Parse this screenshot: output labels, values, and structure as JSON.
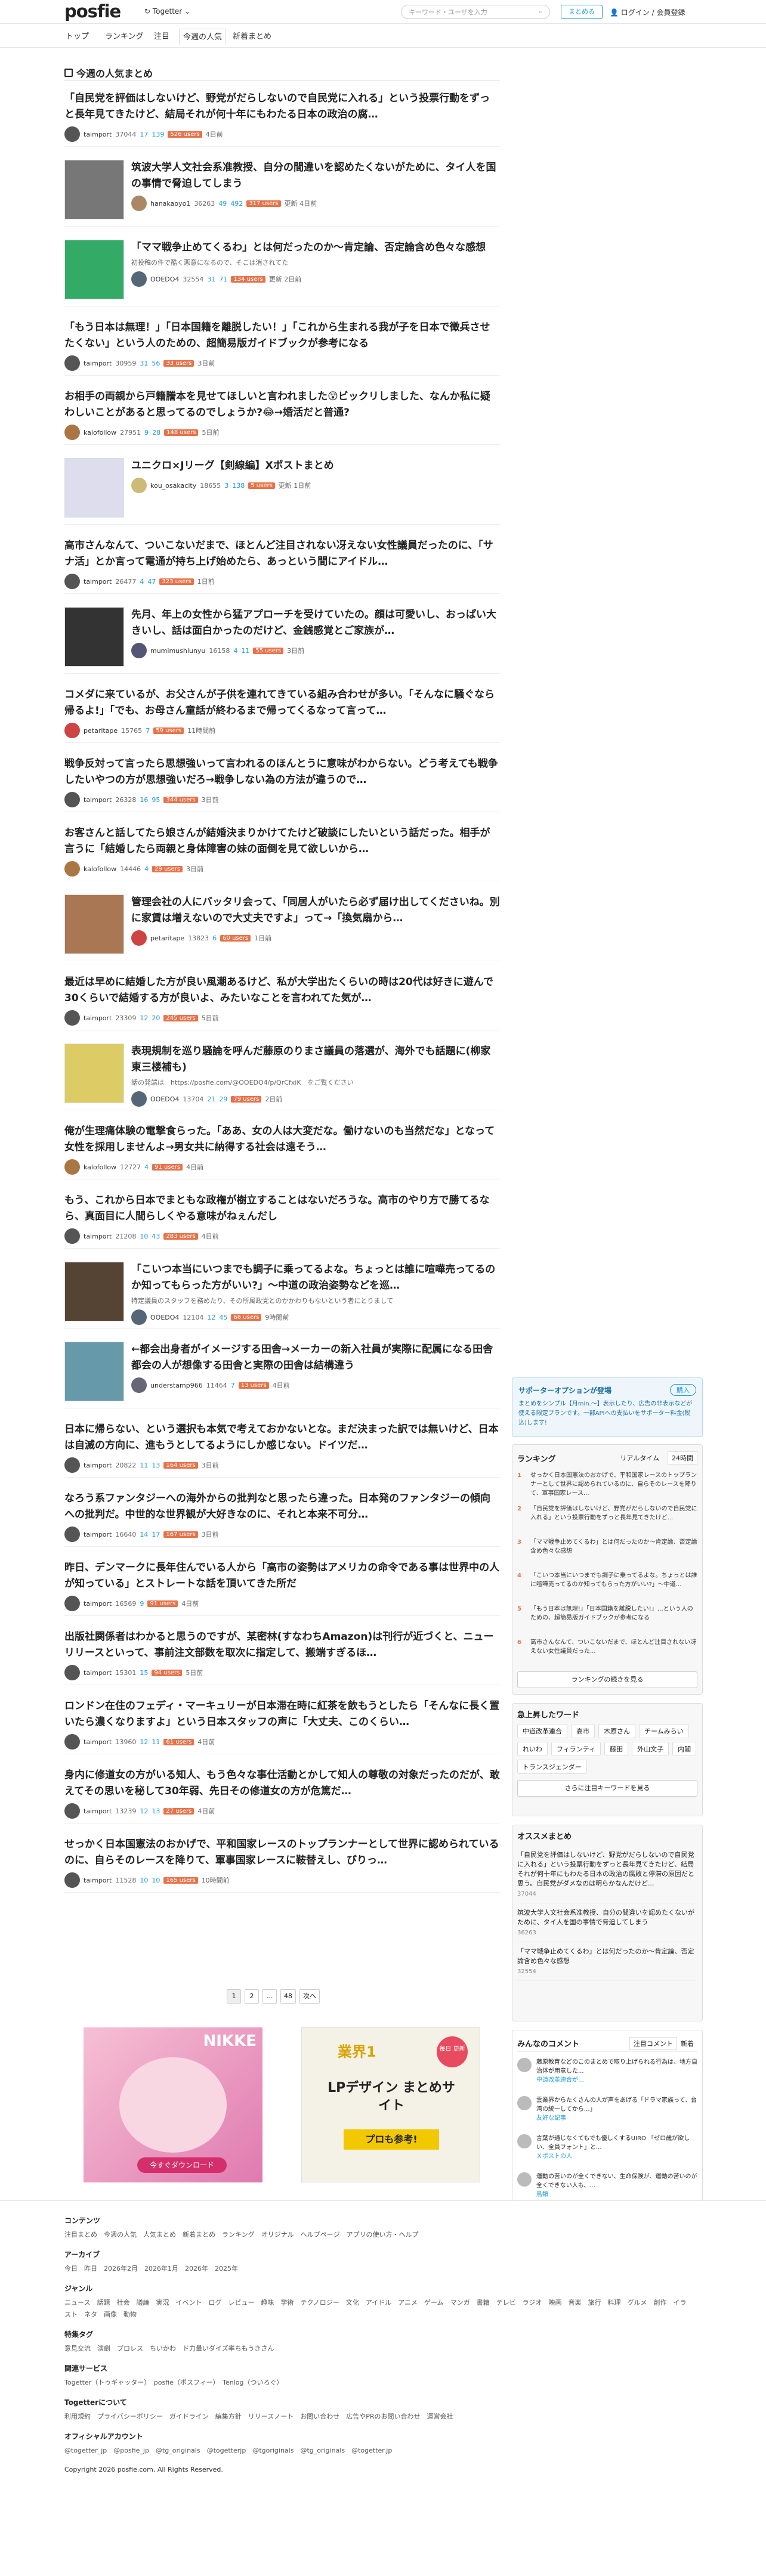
{
  "header": {
    "logo": "posfie",
    "together": "Togetter",
    "search_placeholder": "キーワード・ユーザを入力",
    "create": "まとめる",
    "login": "ログイン / 会員登録"
  },
  "nav": [
    "トップ",
    "ランキング",
    "注目",
    "今週の人気",
    "新着まとめ"
  ],
  "section_title": "今週の人気まとめ",
  "items": [
    {
      "title": "「自民党を評価はしないけど、野党がだらしないので自民党に入れる」という投票行動をずっと長年見てきたけど、結局それが何十年にもわたる日本の政治の腐…",
      "user": "taimport",
      "views": "37044",
      "s1": "17",
      "s2": "139",
      "badge": "526 users",
      "time": "4日前",
      "color": "#555"
    },
    {
      "title": "筑波大学人文社会系准教授、自分の間違いを認めたくないがために、タイ人を国の事情で脅迫してしまう",
      "user": "hanakaoyo1",
      "views": "36263",
      "s1": "49",
      "s2": "492",
      "badge": "317 users",
      "time": "更新 4日前",
      "color": "#a86",
      "thumb": "#777"
    },
    {
      "title": "「ママ戦争止めてくるわ」とは何だったのか〜肯定論、否定論含め色々な感想",
      "desc": "初投稿の件で酷く悪意になるので、そこは消されてた",
      "user": "OOEDO4",
      "views": "32554",
      "s1": "31",
      "s2": "71",
      "badge": "134 users",
      "time": "更新 2日前",
      "color": "#567",
      "thumb": "#3a6"
    },
    {
      "title": "「もう日本は無理！」「日本国籍を離脱したい！」「これから生まれる我が子を日本で徴兵させたくない」という人のための、超簡易版ガイドブックが参考になる",
      "user": "taimport",
      "views": "30959",
      "s1": "31",
      "s2": "56",
      "badge": "33 users",
      "time": "3日前",
      "color": "#555"
    },
    {
      "title": "お相手の両親から戸籍謄本を見せてほしいと言われました😲ビックリしました、なんか私に疑わしいことがあると思ってるのでしょうか?😂→婚活だと普通?",
      "user": "kalofollow",
      "views": "27951",
      "s1": "9",
      "s2": "28",
      "badge": "148 users",
      "time": "5日前",
      "color": "#a74"
    },
    {
      "title": "ユニクロ×Jリーグ【剣線編】Xポストまとめ",
      "user": "kou_osakacity",
      "views": "18655",
      "s1": "3",
      "s2": "138",
      "badge": "5 users",
      "time": "更新 1日前",
      "color": "#cb7",
      "thumb": "#dde"
    },
    {
      "title": "高市さんなんて、ついこないだまで、ほとんど注目されない冴えない女性議員だったのに、「サナ活」とか言って電通が持ち上げ始めたら、あっという間にアイドル…",
      "user": "taimport",
      "views": "26477",
      "s1": "4",
      "s2": "47",
      "badge": "323 users",
      "time": "1日前",
      "color": "#555"
    },
    {
      "title": "先月、年上の女性から猛アプローチを受けていたの。顔は可愛いし、おっぱい大きいし、話は面白かったのだけど、金銭感覚とご家族が…",
      "user": "mumimushiunyu",
      "views": "16158",
      "s1": "4",
      "s2": "11",
      "badge": "55 users",
      "time": "3日前",
      "color": "#557",
      "thumb": "#333"
    },
    {
      "title": "コメダに来ているが、お父さんが子供を連れてきている組み合わせが多い。「そんなに騒ぐなら帰るよ!」「でも、お母さん童話が終わるまで帰ってくるなって言って…",
      "user": "petaritape",
      "views": "15765",
      "s1": "",
      "s2": "7",
      "badge": "59 users",
      "time": "11時間前",
      "color": "#c44"
    },
    {
      "title": "戦争反対って言ったら思想強いって言われるのほんとうに意味がわからない。どう考えても戦争したいやつの方が思想強いだろ→戦争しない為の方法が違うので…",
      "user": "taimport",
      "views": "26328",
      "s1": "16",
      "s2": "95",
      "badge": "344 users",
      "time": "3日前",
      "color": "#555"
    },
    {
      "title": "お客さんと話してたら娘さんが結婚決まりかけてたけど破談にしたいという話だった。相手が言うに「結婚したら両親と身体障害の妹の面倒を見て欲しいから…",
      "user": "kalofollow",
      "views": "14446",
      "s1": "",
      "s2": "4",
      "badge": "29 users",
      "time": "3日前",
      "color": "#a74"
    },
    {
      "title": "管理会社の人にバッタリ会って、「同居人がいたら必ず届け出してくださいね。別に家賃は増えないので大丈夫ですよ」って→「換気扇から…",
      "user": "petaritape",
      "views": "13823",
      "s1": "",
      "s2": "6",
      "badge": "60 users",
      "time": "1日前",
      "color": "#c44",
      "thumb": "#a75"
    },
    {
      "title": "最近は早めに結婚した方が良い風潮あるけど、私が大学出たくらいの時は20代は好きに遊んで30くらいで結婚する方が良いよ、みたいなことを言われてた気が…",
      "user": "taimport",
      "views": "23309",
      "s1": "12",
      "s2": "20",
      "badge": "245 users",
      "time": "5日前",
      "color": "#555"
    },
    {
      "title": "表現規制を巡り騒論を呼んだ藤原のりまさ議員の落選が、海外でも話題に(柳家東三楼補も)",
      "desc": "話の発端は　https://posfie.com/@OOEDO4/p/QrCfxiK　をご覧ください",
      "user": "OOEDO4",
      "views": "13704",
      "s1": "21",
      "s2": "29",
      "badge": "79 users",
      "time": "2日前",
      "color": "#567",
      "thumb": "#dc6"
    },
    {
      "title": "俺が生理痛体験の電撃食らった。「ああ、女の人は大変だな。働けないのも当然だな」となって女性を採用しませんよ→男女共に納得する社会は遠そう…",
      "user": "kalofollow",
      "views": "12727",
      "s1": "",
      "s2": "4",
      "badge": "91 users",
      "time": "4日前",
      "color": "#a74"
    },
    {
      "title": "もう、これから日本でまともな政権が樹立することはないだろうな。高市のやり方で勝てるなら、真面目に人間らしくやる意味がねぇんだし",
      "user": "taimport",
      "views": "21208",
      "s1": "10",
      "s2": "43",
      "badge": "283 users",
      "time": "4日前",
      "color": "#555"
    },
    {
      "title": "「こいつ本当にいつまでも調子に乗ってるよな。ちょっとは誰に喧嘩売ってるのか知ってもらった方がいい?」〜中道の政治姿勢などを巡…",
      "desc": "特定議員のスタッフを務めたり、その所属政党とのかかわりもないという者にとりまして",
      "user": "OOEDO4",
      "views": "12104",
      "s1": "12",
      "s2": "45",
      "badge": "66 users",
      "time": "9時間前",
      "color": "#567",
      "thumb": "#543"
    },
    {
      "title": "←都会出身者がイメージする田舎→メーカーの新入社員が実際に配属になる田舎 都会の人が想像する田舎と実際の田舎は結構違う",
      "user": "understamp966",
      "views": "11464",
      "s1": "",
      "s2": "7",
      "badge": "13 users",
      "time": "4日前",
      "color": "#667",
      "thumb": "#69a"
    },
    {
      "title": "日本に帰らない、という選択も本気で考えておかないとな。まだ決まった訳では無いけど、日本は自滅の方向に、進もうとしてるようにしか感じない。ドイツだ…",
      "user": "taimport",
      "views": "20822",
      "s1": "11",
      "s2": "13",
      "badge": "164 users",
      "time": "3日前",
      "color": "#555"
    },
    {
      "title": "なろう系ファンタジーへの海外からの批判なと思ったら違った。日本発のファンタジーの傾向への批判だ。中世的な世界観が大好きなのに、それと本来不可分…",
      "user": "taimport",
      "views": "16640",
      "s1": "14",
      "s2": "17",
      "badge": "167 users",
      "time": "3日前",
      "color": "#555"
    },
    {
      "title": "昨日、デンマークに長年住んでいる人から「高市の姿勢はアメリカの命令である事は世界中の人が知っている」とストレートな話を頂いてきた所だ",
      "user": "taimport",
      "views": "16569",
      "s1": "",
      "s2": "9",
      "badge": "91 users",
      "time": "4日前",
      "color": "#555"
    },
    {
      "title": "出版社関係者はわかると思うのですが、某密林(すなわちAmazon)は刊行が近づくと、ニューリリースといって、事前注文部数を取次に指定して、搬端すぎるほ…",
      "user": "taimport",
      "views": "15301",
      "s1": "",
      "s2": "15",
      "badge": "94 users",
      "time": "5日前",
      "color": "#555"
    },
    {
      "title": "ロンドン在住のフェディ・マーキュリーが日本滞在時に紅茶を飲もうとしたら「そんなに長く置いたら濃くなりますよ」という日本スタッフの声に「大丈夫、このくらい…",
      "user": "taimport",
      "views": "13960",
      "s1": "12",
      "s2": "11",
      "badge": "61 users",
      "time": "4日前",
      "color": "#555"
    },
    {
      "title": "身内に修道女の方がいる知人、もう色々な事仕活動とかして知人の尊敬の対象だったのだが、敢えてその思いを秘して30年弱、先日その修道女の方が危篤だ…",
      "user": "taimport",
      "views": "13239",
      "s1": "12",
      "s2": "13",
      "badge": "27 users",
      "time": "4日前",
      "color": "#555"
    },
    {
      "title": "せっかく日本国憲法のおかげで、平和国家レースのトップランナーとして世界に認められているのに、自らそのレースを降りて、軍事国家レースに鞍替えし、びりっ…",
      "user": "taimport",
      "views": "11528",
      "s1": "10",
      "s2": "10",
      "badge": "165 users",
      "time": "10時間前",
      "color": "#555"
    }
  ],
  "pagination": [
    "1",
    "2",
    "…",
    "48",
    "次へ"
  ],
  "ads": {
    "left": "NIKKE",
    "left_sub": "今すぐダウンロード",
    "right_title": "業界1",
    "right_main": "LPデザイン まとめサイト",
    "right_sub": "プロも参考!",
    "right_tag": "毎日 更新"
  },
  "sidebar": {
    "supporter_title": "サポーターオプションが登場",
    "supporter_btn": "購入",
    "supporter_text": "まとめをシンプル【月min.〜】表示したり、広告の非表示などが使える限定プランです。一部APIへの支払いをサポーター料金(税込)します!",
    "ranking_title": "ランキング",
    "ranking_tabs": [
      "リアルタイム",
      "24時間"
    ],
    "ranking": [
      "せっかく日本国憲法のおかげで、平和国家レースのトップランナーとして世界に認められているのに、自らそのレースを降りて、軍事国家レース...",
      "「自民党を評価はしないけど、野党がだらしないので自民党に入れる」という投票行動をずっと長年見てきたけど...",
      "「ママ戦争止めてくるわ」とは何だったのか〜肯定論、否定論含め色々な感想",
      "「こいつ本当にいつまでも調子に乗ってるよな。ちょっとは誰に喧嘩売ってるのか知ってもらった方がいい?」〜中道...",
      "「もう日本は無理!」「日本国籍を離脱したい!」…という人のための、超簡易版ガイドブックが参考になる",
      "高市さんなんて、ついこないだまで、ほとんど注目されない冴えない女性議員だった..."
    ],
    "ranking_more": "ランキングの続きを見る",
    "kw_title": "急上昇したワード",
    "keywords": [
      "中道改革連合",
      "高市",
      "木原さん",
      "チームみらい",
      "れいわ",
      "フィランティ",
      "藤田",
      "外山文子",
      "内閣",
      "トランスジェンダー"
    ],
    "kw_more": "さらに注目キーワードを見る",
    "osusume_title": "オススメまとめ",
    "osusume": [
      "「自民党を評価はしないけど、野党がだらしないので自民党に入れる」という投票行動をずっと長年見てきたけど、結局それが何十年にもわたる日本の政治の腐敗と停滞の原因だと思う。自民党がダメなのは明らかなんだけど...",
      "筑波大学人文社会系准教授、自分の間違いを認めたくないがために、タイ人を国の事情で脅迫してしまう",
      "「ママ戦争止めてくるわ」とは何だったのか〜肯定論、否定論含め色々な感想"
    ],
    "osusume_meta": [
      "37044",
      "36263",
      "32554"
    ],
    "comments_title": "みんなのコメント",
    "comments_tabs": [
      "注目コメント",
      "新着"
    ],
    "comments": [
      "藤原教育などのこのまとめで取り上げられる行為は、地方自治体が用意した...",
      "雲業界からたくさんの人が声をあげる「ドラマ家族って、台湾の統一してから…」",
      "言葉が通じなくてもでも優しくするUIRO 「ゼロ歳が欲しい、全員フォント」と...",
      "運動の苦いのが全くできない、生命保険が、運動の苦いのが全くできない人も、..."
    ],
    "comments_from": [
      "中道改革連合が…",
      "友好な記事",
      "Ｘポストの人",
      "鳥類"
    ]
  },
  "footer": {
    "contents_h": "コンテンツ",
    "contents": "注目まとめ　今週の人気　人気まとめ　新着まとめ　ランキング　オリジナル　ヘルプページ　アプリの使い方・ヘルプ",
    "archive_h": "アーカイブ",
    "archive": "今日　昨日　2026年2月　2026年1月　2026年　2025年",
    "genre_h": "ジャンル",
    "genre": "ニュース　話題　社会　議論　実況　イベント　ログ　レビュー　趣味　学術　テクノロジー　文化　アイドル　アニメ　ゲーム　マンガ　書籍　テレビ　ラジオ　映画　音楽　旅行　料理　グルメ　創作　イラスト　ネタ　画像　動物",
    "special_h": "特集タグ",
    "special": "意見交流　演劇　プロレス　ちいかわ　ド力量いダイズ率ちもうきさん",
    "related_h": "関連サービス",
    "related": "Togetter（トゥギャッター）　posfie（ポスフィー）　Tenlog（ついろぐ）",
    "tg_h": "Togetterについて",
    "tg": "利用規約　プライバシーポリシー　ガイドライン　編集方針　リリースノート　お問い合わせ　広告やPRのお問い合わせ　運営会社",
    "official_h": "オフィシャルアカウント",
    "official": "@togetter_jp　@posfie_jp　@tg_originals　@togetterjp　@tgoriginals　@tg_originals　@togetter.jp",
    "copy": "Copyright 2026 posfie.com. All Rights Reserved."
  }
}
